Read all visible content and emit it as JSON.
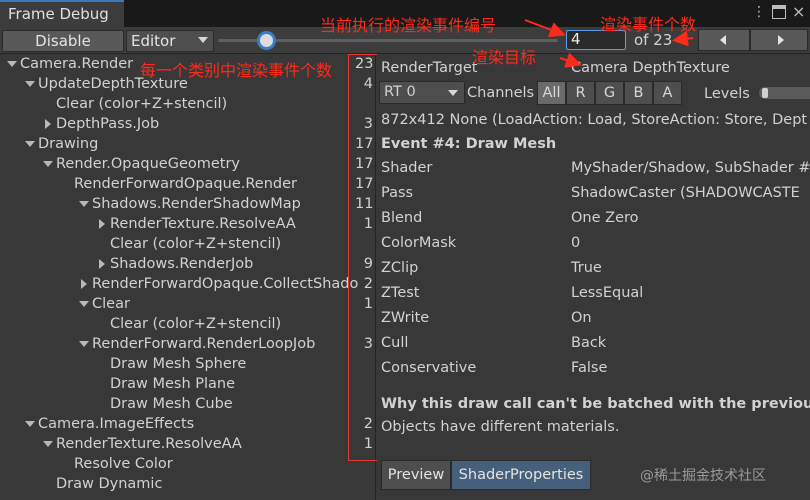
{
  "window": {
    "tab_title": "Frame Debug"
  },
  "toolbar": {
    "disable_label": "Disable",
    "mode_selected": "Editor",
    "event_current": "4",
    "event_total_label": "of 23"
  },
  "tree": {
    "rows": [
      {
        "label": "Camera.Render",
        "count": "23",
        "fold": "down"
      },
      {
        "label": "UpdateDepthTexture",
        "count": "4",
        "fold": "down"
      },
      {
        "label": "Clear (color+Z+stencil)",
        "count": "",
        "fold": "none"
      },
      {
        "label": "DepthPass.Job",
        "count": "3",
        "fold": "right"
      },
      {
        "label": "Drawing",
        "count": "17",
        "fold": "down"
      },
      {
        "label": "Render.OpaqueGeometry",
        "count": "17",
        "fold": "down"
      },
      {
        "label": "RenderForwardOpaque.Render",
        "count": "17",
        "fold": "none"
      },
      {
        "label": "Shadows.RenderShadowMap",
        "count": "11",
        "fold": "down"
      },
      {
        "label": "RenderTexture.ResolveAA",
        "count": "1",
        "fold": "right"
      },
      {
        "label": "Clear (color+Z+stencil)",
        "count": "",
        "fold": "none"
      },
      {
        "label": "Shadows.RenderJob",
        "count": "9",
        "fold": "right"
      },
      {
        "label": "RenderForwardOpaque.CollectShado",
        "count": "2",
        "fold": "right"
      },
      {
        "label": "Clear",
        "count": "1",
        "fold": "down"
      },
      {
        "label": "Clear (color+Z+stencil)",
        "count": "",
        "fold": "none"
      },
      {
        "label": "RenderForward.RenderLoopJob",
        "count": "3",
        "fold": "down"
      },
      {
        "label": "Draw Mesh Sphere",
        "count": "",
        "fold": "none"
      },
      {
        "label": "Draw Mesh Plane",
        "count": "",
        "fold": "none"
      },
      {
        "label": "Draw Mesh Cube",
        "count": "",
        "fold": "none"
      },
      {
        "label": "Camera.ImageEffects",
        "count": "2",
        "fold": "down"
      },
      {
        "label": "RenderTexture.ResolveAA",
        "count": "1",
        "fold": "down"
      },
      {
        "label": "Resolve Color",
        "count": "",
        "fold": "none"
      },
      {
        "label": "Draw Dynamic",
        "count": "",
        "fold": "none"
      }
    ]
  },
  "details": {
    "render_target_label": "RenderTarget",
    "render_target_value": "Camera DepthTexture",
    "rt_selected": "RT 0",
    "channels_label": "Channels",
    "channels": [
      "All",
      "R",
      "G",
      "B",
      "A"
    ],
    "levels_label": "Levels",
    "target_info": "872x412 None (LoadAction: Load, StoreAction: Store, Dept",
    "event_title": "Event #4: Draw Mesh",
    "properties": [
      {
        "label": "Shader",
        "value": "MyShader/Shadow, SubShader #"
      },
      {
        "label": "Pass",
        "value": "ShadowCaster (SHADOWCASTE"
      },
      {
        "label": "Blend",
        "value": "One Zero"
      },
      {
        "label": "ColorMask",
        "value": "0"
      },
      {
        "label": "ZClip",
        "value": "True"
      },
      {
        "label": "ZTest",
        "value": "LessEqual"
      },
      {
        "label": "ZWrite",
        "value": "On"
      },
      {
        "label": "Cull",
        "value": "Back"
      },
      {
        "label": "Conservative",
        "value": "False"
      }
    ],
    "batch_title": "Why this draw call can't be batched with the previous one",
    "batch_reason": "Objects have different materials.",
    "preview_tab": "Preview",
    "shader_props_tab": "ShaderProperties"
  },
  "annotations": {
    "current_event_note": "当前执行的渲染事件编号",
    "event_count_note": "渲染事件个数",
    "render_target_note": "渲染目标",
    "category_count_note": "每一个类别中渲染事件个数"
  },
  "watermark": "@稀土掘金技术社区",
  "colors": {
    "annotation_red": "#ff2a1a",
    "accent_blue": "#3c7bc8",
    "active_tab": "#46607c"
  }
}
